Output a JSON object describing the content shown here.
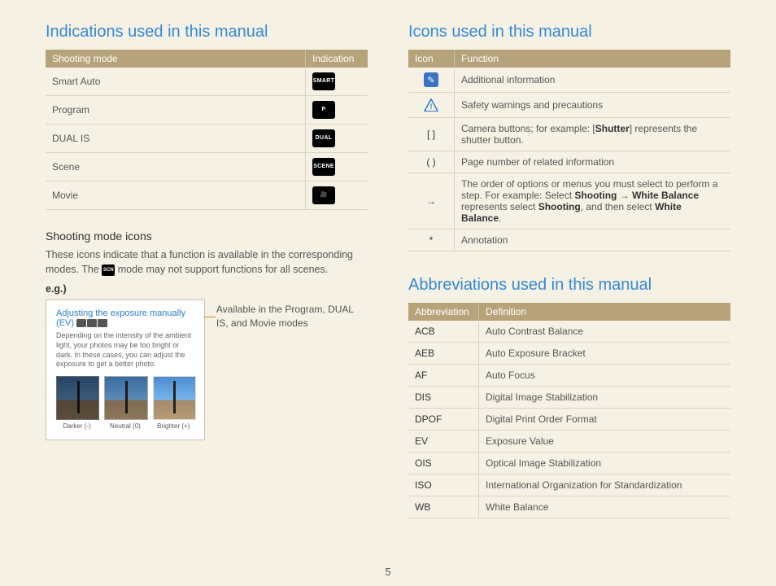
{
  "page_number": "5",
  "left": {
    "title": "Indications used in this manual",
    "table_headers": [
      "Shooting mode",
      "Indication"
    ],
    "table_rows": [
      {
        "mode": "Smart Auto",
        "icon_label": "SMART"
      },
      {
        "mode": "Program",
        "icon_label": "P"
      },
      {
        "mode": "DUAL IS",
        "icon_label": "DUAL"
      },
      {
        "mode": "Scene",
        "icon_label": "SCENE"
      },
      {
        "mode": "Movie",
        "icon_label": "🎥"
      }
    ],
    "subheading": "Shooting mode icons",
    "body_pre": "These icons indicate that a function is available in the corresponding modes. The ",
    "body_icon_label": "SCN",
    "body_post": " mode may not support functions for all scenes.",
    "eg_label": "e.g.)",
    "example": {
      "title": "Adjusting the exposure manually (EV)",
      "desc": "Depending on the intensity of the ambient light, your photos may be too bright or dark. In these cases, you can adjust the exposure to get a better photo.",
      "thumb_labels": [
        "Darker (-)",
        "Neutral (0)",
        "Brighter (+)"
      ]
    },
    "example_callout": "Available in the Program, DUAL IS, and Movie modes"
  },
  "right": {
    "icons_title": "Icons used in this manual",
    "icons_headers": [
      "Icon",
      "Function"
    ],
    "icons_rows": [
      {
        "icon_type": "info",
        "icon_text": "✎",
        "func_plain": "Additional information"
      },
      {
        "icon_type": "warn",
        "icon_text": "!",
        "func_plain": "Safety warnings and precautions"
      },
      {
        "icon_type": "text",
        "icon_text": "[  ]",
        "func_html": "Camera buttons; for example: [<span class='strong'>Shutter</span>] represents the shutter button."
      },
      {
        "icon_type": "text",
        "icon_text": "(  )",
        "func_plain": "Page number of related information"
      },
      {
        "icon_type": "text",
        "icon_text": "→",
        "func_html": "The order of options or menus you must select to perform a step. For example: Select <span class='strong'>Shooting</span> → <span class='strong'>White Balance</span> represents select <span class='strong'>Shooting</span>, and then select <span class='strong'>White Balance</span>."
      },
      {
        "icon_type": "text",
        "icon_text": "*",
        "func_plain": "Annotation"
      }
    ],
    "abbr_title": "Abbreviations used in this manual",
    "abbr_headers": [
      "Abbreviation",
      "Definition"
    ],
    "abbr_rows": [
      {
        "abbr": "ACB",
        "def": "Auto Contrast Balance"
      },
      {
        "abbr": "AEB",
        "def": "Auto Exposure Bracket"
      },
      {
        "abbr": "AF",
        "def": "Auto Focus"
      },
      {
        "abbr": "DIS",
        "def": "Digital Image Stabilization"
      },
      {
        "abbr": "DPOF",
        "def": "Digital Print Order Format"
      },
      {
        "abbr": "EV",
        "def": "Exposure Value"
      },
      {
        "abbr": "OIS",
        "def": "Optical Image Stabilization"
      },
      {
        "abbr": "ISO",
        "def": "International Organization for Standardization"
      },
      {
        "abbr": "WB",
        "def": "White Balance"
      }
    ]
  }
}
